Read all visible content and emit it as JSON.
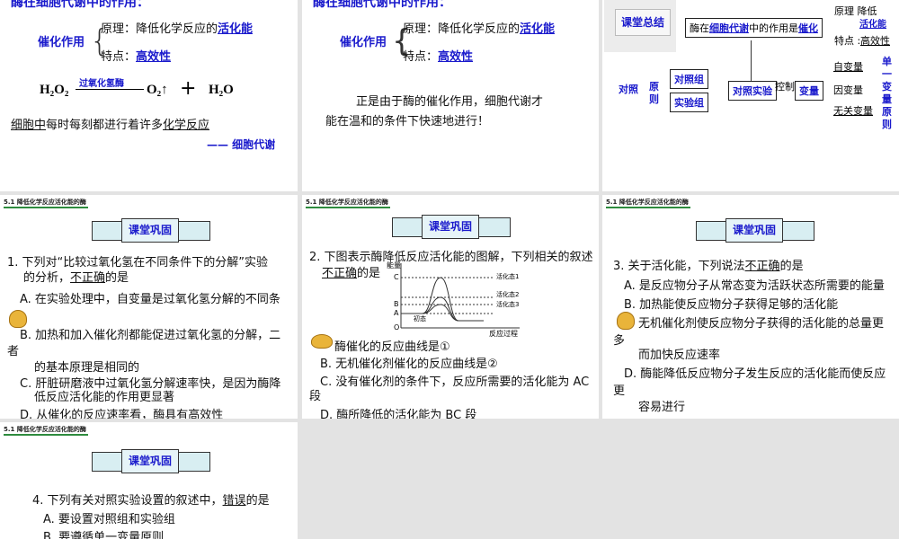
{
  "slide1": {
    "title": "酶在细胞代谢中的作用：",
    "catalysis": "催化作用",
    "principle_label": "原理：降低化学反应的",
    "principle_value": "活化能",
    "feature_label": "特点：",
    "feature_value": "高效性",
    "eq_left": "H₂O₂",
    "eq_enzyme": "过氧化氢酶",
    "eq_o2": "O₂↑",
    "eq_plus": "+",
    "eq_h2o": "H₂O",
    "sentence_a": "细胞中",
    "sentence_b": "每时每刻都进行着许多",
    "sentence_c": "化学反应",
    "conclusion": "—— 细胞代谢"
  },
  "slide2": {
    "title": "酶在细胞代谢中的作用：",
    "catalysis": "催化作用",
    "principle_label": "原理：降低化学反应的",
    "principle_value": "活化能",
    "feature_label": "特点：",
    "feature_value": "高效性",
    "line1": "正是由于酶的催化作用，细胞代谢才",
    "line2": "能在温和的条件下快速地进行！"
  },
  "slide3": {
    "badge": "课堂总结",
    "main_box_a": "酶在",
    "main_box_b": "细胞代谢",
    "main_box_c": "中的作用是",
    "main_box_d": "催化",
    "principle": "原理 降低",
    "principle_value": "活化能",
    "feature": "特点 :",
    "feature_value": "高效性",
    "control_principle_a": "对照",
    "control_principle_b": "原则",
    "control_group": "对照组",
    "experiment_group": "实验组",
    "controlled_experiment": "对照实验",
    "control": "控制",
    "variable": "变量",
    "independent": "自变量",
    "dependent": "因变量",
    "irrelevant": "无关变量",
    "single_variable": "单一变量原则"
  },
  "header": "5.1  降低化学反应活化能的酶",
  "banner": "课堂巩固",
  "q1": {
    "stem1": "1. 下列对“比较过氧化氢在不同条件下的分解”实验",
    "stem2": "的分析，",
    "stem_u": "不正确",
    "stem3": "的是",
    "A": "A. 在实验处理中，自变量是过氧化氢分解的不同条",
    "B1": "B. 加热和加入催化剂都能促进过氧化氢的分解，二",
    "B2": "者",
    "B3": "的基本原理是相同的",
    "C1": "C. 肝脏研磨液中过氧化氢分解速率快，是因为酶降",
    "C2": "低反应活化能的作用更显著",
    "D": "D. 从催化的反应速率看，酶具有高效性"
  },
  "q2": {
    "stem1": "2. 下图表示酶降低反应活化能的图解，下列相关的叙述",
    "stem_u": "不正确",
    "stem2": "的是",
    "graph": {
      "ylabel": "能量",
      "xlabel": "反应过程",
      "C": "C",
      "B": "B",
      "A": "A",
      "O": "O",
      "s1": "活化态1",
      "s2": "活化态2",
      "s3": "活化态3",
      "init": "初态"
    },
    "A": "酶催化的反应曲线是①",
    "B": "B. 无机催化剂催化的反应曲线是②",
    "C1": "C. 没有催化剂的条件下，反应所需要的活化能为 AC",
    "C2": "段",
    "D": "D. 酶所降低的活化能为 BC 段"
  },
  "q3": {
    "stem1": "3. 关于活化能，下列说法",
    "stem_u": "不正确",
    "stem2": "的是",
    "A": "A. 是反应物分子从常态变为活跃状态所需要的能量",
    "B": "B. 加热能使反应物分子获得足够的活化能",
    "C1": "无机催化剂使反应物分子获得的活化能的总量更",
    "C2": "多",
    "C3": "而加快反应速率",
    "D1": "D. 酶能降低反应物分子发生反应的活化能而使反应",
    "D2": "更",
    "D3": "容易进行"
  },
  "q4": {
    "stem1": "4. 下列有关对照实验设置的叙述中，",
    "stem_u": "错误",
    "stem2": "的是",
    "A": "A. 要设置对照组和实验组",
    "B": "B. 要遵循单一变量原则"
  }
}
